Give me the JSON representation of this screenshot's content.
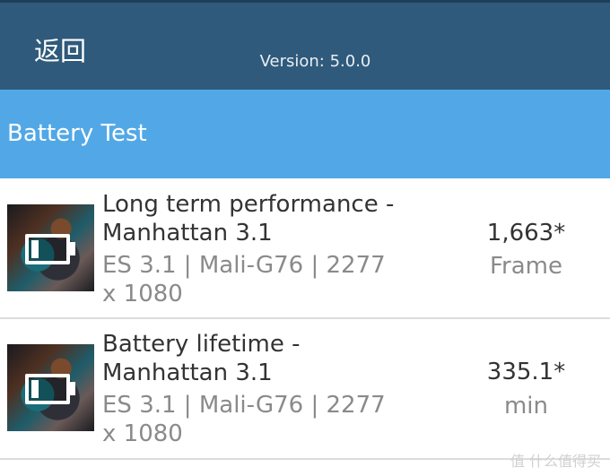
{
  "header": {
    "back_label": "返回",
    "version": "Version: 5.0.0"
  },
  "section": {
    "title": "Battery Test"
  },
  "tests": [
    {
      "title": "Long term performance - Manhattan 3.1",
      "subtitle": "ES 3.1 | Mali-G76 | 2277 x 1080",
      "score": "1,663*",
      "unit": "Frame"
    },
    {
      "title": "Battery lifetime - Manhattan 3.1",
      "subtitle": "ES 3.1 | Mali-G76 | 2277 x 1080",
      "score": "335.1*",
      "unit": "min"
    }
  ],
  "watermark": "值 什么值得买"
}
